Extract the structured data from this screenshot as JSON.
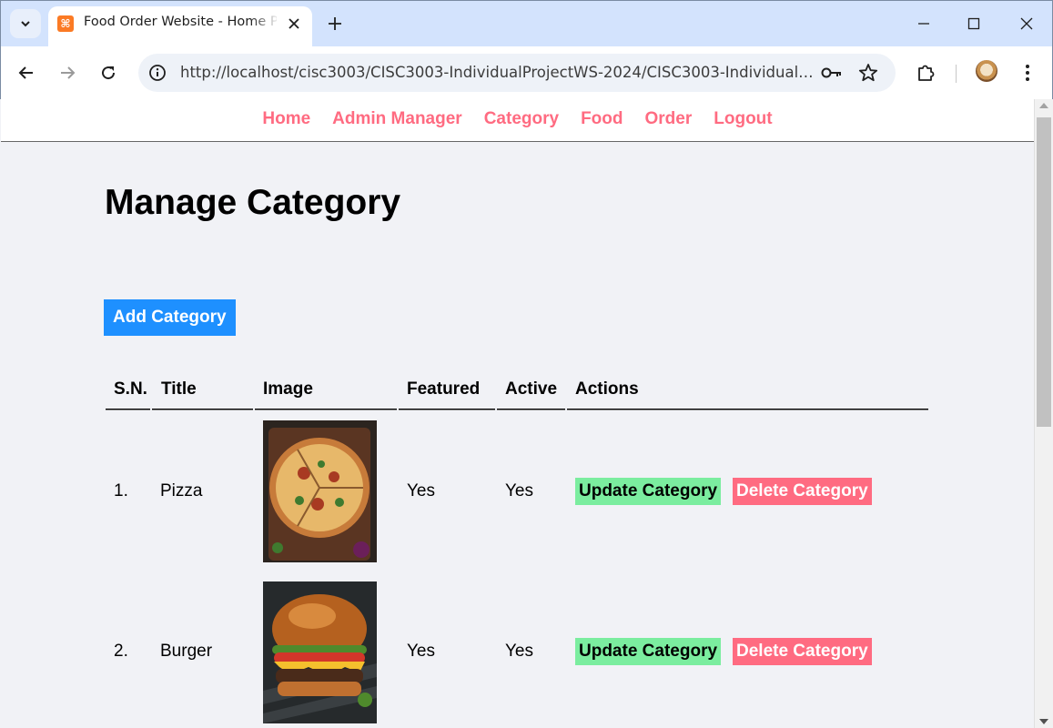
{
  "browser": {
    "tab_title": "Food Order Website - Home Page",
    "favicon_glyph": "⌘",
    "url": "http://localhost/cisc3003/CISC3003-IndividualProjectWS-2024/CISC3003-IndividualProject..."
  },
  "menu": {
    "items": [
      "Home",
      "Admin Manager",
      "Category",
      "Food",
      "Order",
      "Logout"
    ]
  },
  "page": {
    "title": "Manage Category",
    "add_button": "Add Category"
  },
  "table": {
    "headers": [
      "S.N.",
      "Title",
      "Image",
      "Featured",
      "Active",
      "Actions"
    ],
    "rows": [
      {
        "sn": "1.",
        "title": "Pizza",
        "featured": "Yes",
        "active": "Yes",
        "update": "Update Category",
        "delete": "Delete Category"
      },
      {
        "sn": "2.",
        "title": "Burger",
        "featured": "Yes",
        "active": "Yes",
        "update": "Update Category",
        "delete": "Delete Category"
      }
    ]
  },
  "colors": {
    "accent_link": "#ff6b81",
    "primary_button": "#1e90ff",
    "update_button": "#7bed9f",
    "delete_button": "#ff6b81"
  }
}
